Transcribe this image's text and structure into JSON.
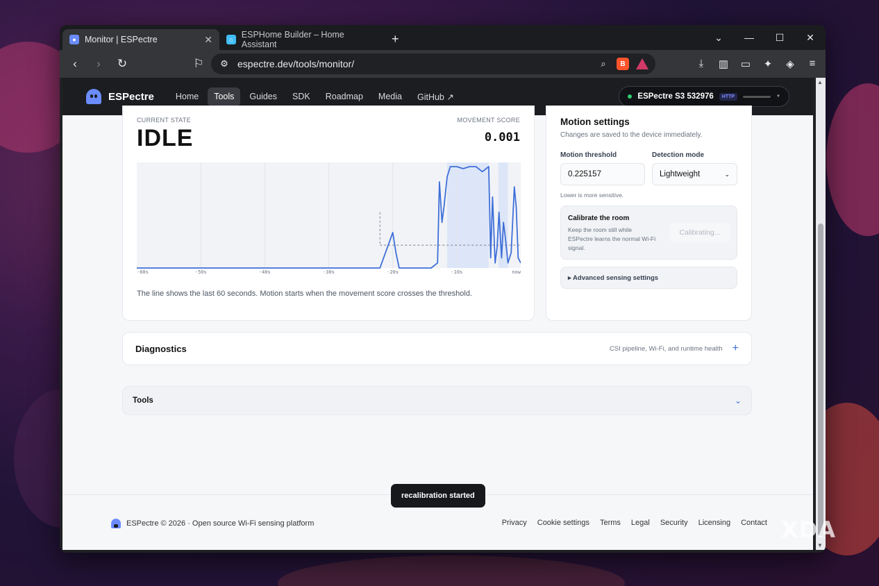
{
  "browser": {
    "tabs": [
      {
        "title": "Monitor | ESPectre",
        "active": true
      },
      {
        "title": "ESPHome Builder – Home Assistant",
        "active": false
      }
    ],
    "url": "espectre.dev/tools/monitor/",
    "icons": [
      "back-icon",
      "forward-icon",
      "reload-icon",
      "bookmark-icon",
      "site-info-icon",
      "zoom-icon",
      "brave-shield-icon",
      "brave-rewards-icon",
      "download-icon",
      "sidebar-icon",
      "wallet-icon",
      "leo-icon",
      "vpn-icon",
      "menu-icon"
    ]
  },
  "site": {
    "brand": "ESPectre",
    "nav": [
      "Home",
      "Tools",
      "Guides",
      "SDK",
      "Roadmap",
      "Media",
      "GitHub ↗"
    ],
    "active_nav": "Tools",
    "device": {
      "name": "ESPectre S3 532976",
      "protocol": "HTTP",
      "status_color": "#2ecc71"
    }
  },
  "monitor": {
    "state_label": "CURRENT STATE",
    "state": "IDLE",
    "score_label": "MOVEMENT SCORE",
    "score": "0.001",
    "caption": "The line shows the last 60 seconds. Motion starts when the movement score crosses the threshold.",
    "chart_data": {
      "type": "line",
      "x_ticks": [
        "-60s",
        "-50s",
        "-40s",
        "-30s",
        "-20s",
        "-10s",
        "now"
      ],
      "x": [
        -60,
        -22,
        -20,
        -19.5,
        -19,
        -18.5,
        -17,
        -15,
        -14,
        -13,
        -12.7,
        -12.3,
        -12,
        -11.5,
        -11,
        -10.5,
        -10,
        -9,
        -8,
        -7,
        -6,
        -5,
        -4.7,
        -4.4,
        -4,
        -3.7,
        -3.4,
        -3,
        -2.7,
        -2.4,
        -2,
        -1.5,
        -1,
        -0.7,
        -0.4,
        0
      ],
      "y": [
        0,
        0,
        0.35,
        0.15,
        0,
        0,
        0,
        0,
        0,
        0.05,
        0.85,
        0.45,
        0.6,
        0.9,
        1.0,
        1.0,
        1.0,
        0.98,
        1.0,
        1.0,
        0.95,
        1.0,
        0.1,
        0.7,
        0.05,
        0.2,
        0.55,
        0.1,
        0.45,
        0.3,
        0.05,
        0.15,
        0.8,
        0.6,
        0.1,
        0.05
      ],
      "threshold": 0.225,
      "threshold_start": -22,
      "motion_bands": [
        [
          -11.5,
          -5
        ],
        [
          -3.5,
          -2
        ]
      ],
      "series_color": "#3f6fd8"
    }
  },
  "settings": {
    "title": "Motion settings",
    "subtitle": "Changes are saved to the device immediately.",
    "threshold_label": "Motion threshold",
    "threshold_value": "0.225157",
    "mode_label": "Detection mode",
    "mode_value": "Lightweight",
    "hint": "Lower is more sensitive.",
    "calibrate_title": "Calibrate the room",
    "calibrate_text": "Keep the room still while ESPectre learns the normal Wi-Fi signal.",
    "calibrate_button": "Calibrating...",
    "advanced": "▸ Advanced sensing settings"
  },
  "diagnostics": {
    "title": "Diagnostics",
    "summary": "CSI pipeline, Wi-Fi, and runtime health"
  },
  "tools": {
    "title": "Tools"
  },
  "toast": "recalibration started",
  "footer": {
    "text": "ESPectre © 2026 · Open source Wi-Fi sensing platform",
    "links": [
      "Privacy",
      "Cookie settings",
      "Terms",
      "Legal",
      "Security",
      "Licensing",
      "Contact"
    ]
  },
  "watermark": "XDA"
}
